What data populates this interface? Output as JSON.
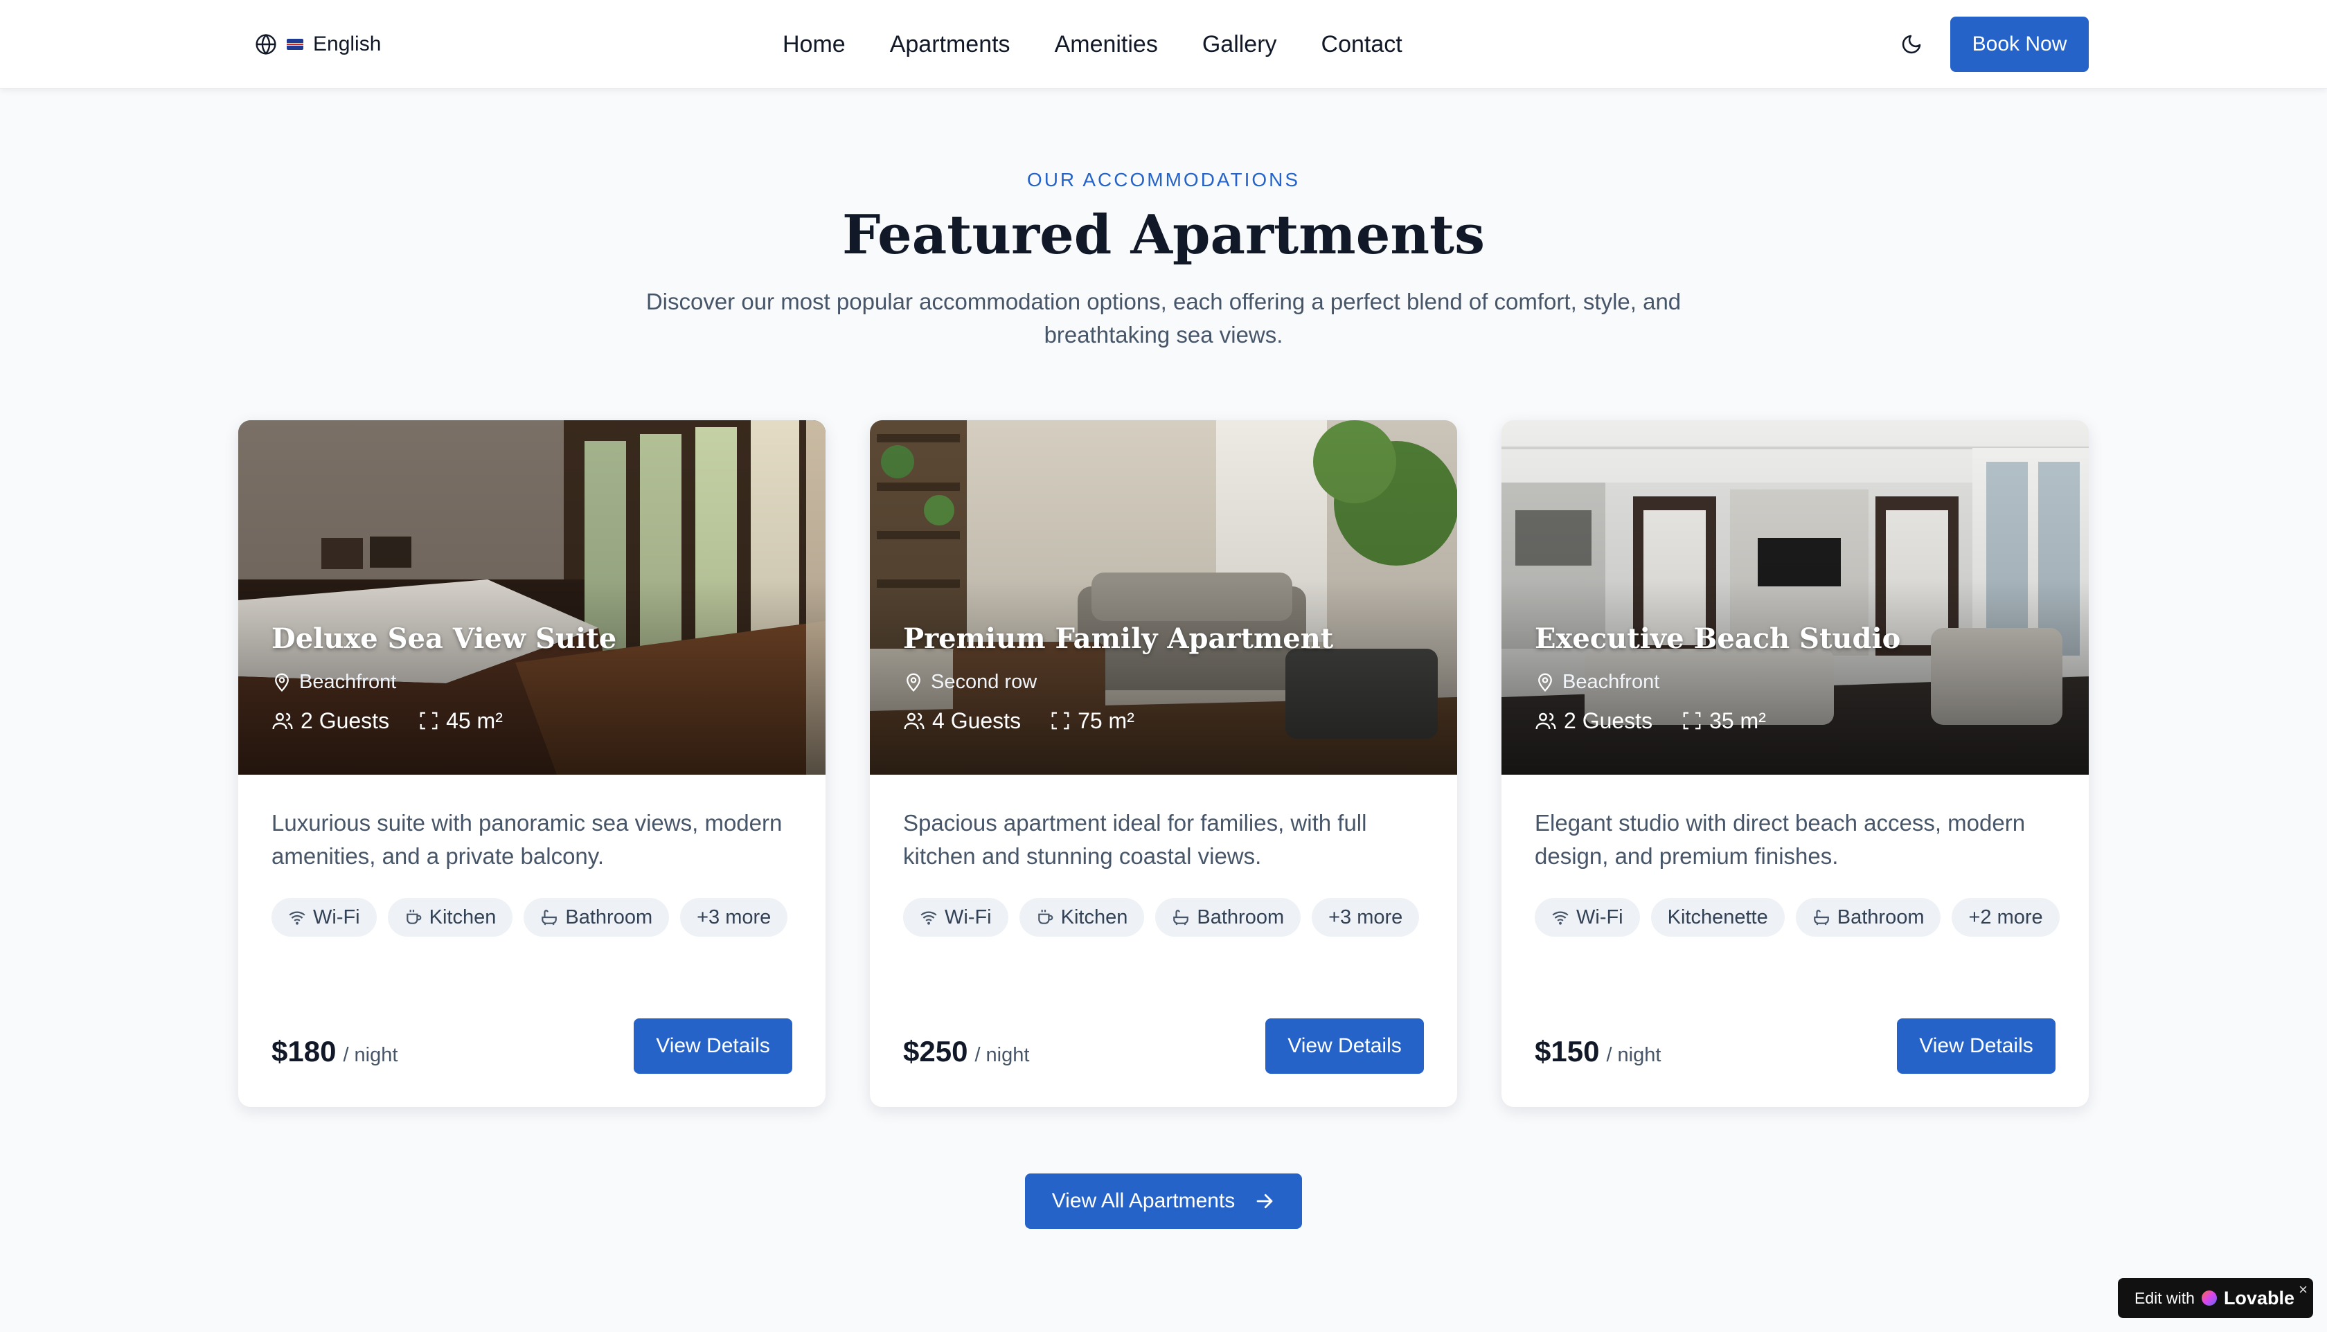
{
  "nav": {
    "language": "English",
    "links": [
      "Home",
      "Apartments",
      "Amenities",
      "Gallery",
      "Contact"
    ],
    "book_label": "Book Now",
    "theme_icon": "moon-icon"
  },
  "section": {
    "eyebrow": "OUR ACCOMMODATIONS",
    "title": "Featured Apartments",
    "subtitle": "Discover our most popular accommodation options, each offering a perfect blend of comfort, style, and breathtaking sea views."
  },
  "cards": [
    {
      "title": "Deluxe Sea View Suite",
      "location": "Beachfront",
      "guests": "2 Guests",
      "area": "45 m²",
      "description": "Luxurious suite with panoramic sea views, modern amenities, and a private balcony.",
      "tags": [
        {
          "label": "Wi-Fi",
          "icon": "wifi-icon"
        },
        {
          "label": "Kitchen",
          "icon": "coffee-icon"
        },
        {
          "label": "Bathroom",
          "icon": "bath-icon"
        }
      ],
      "more": "+3 more",
      "price": "$180",
      "unit": "/ night",
      "button": "View Details"
    },
    {
      "title": "Premium Family Apartment",
      "location": "Second row",
      "guests": "4 Guests",
      "area": "75 m²",
      "description": "Spacious apartment ideal for families, with full kitchen and stunning coastal views.",
      "tags": [
        {
          "label": "Wi-Fi",
          "icon": "wifi-icon"
        },
        {
          "label": "Kitchen",
          "icon": "coffee-icon"
        },
        {
          "label": "Bathroom",
          "icon": "bath-icon"
        }
      ],
      "more": "+3 more",
      "price": "$250",
      "unit": "/ night",
      "button": "View Details"
    },
    {
      "title": "Executive Beach Studio",
      "location": "Beachfront",
      "guests": "2 Guests",
      "area": "35 m²",
      "description": "Elegant studio with direct beach access, modern design, and premium finishes.",
      "tags": [
        {
          "label": "Wi-Fi",
          "icon": "wifi-icon"
        },
        {
          "label": "Kitchenette",
          "icon": ""
        },
        {
          "label": "Bathroom",
          "icon": "bath-icon"
        }
      ],
      "more": "+2 more",
      "price": "$150",
      "unit": "/ night",
      "button": "View Details"
    }
  ],
  "view_all": "View All Apartments",
  "badge": {
    "prefix": "Edit with",
    "brand": "Lovable"
  },
  "colors": {
    "accent": "#2563c9",
    "background": "#f8fafc",
    "card": "#ffffff"
  }
}
